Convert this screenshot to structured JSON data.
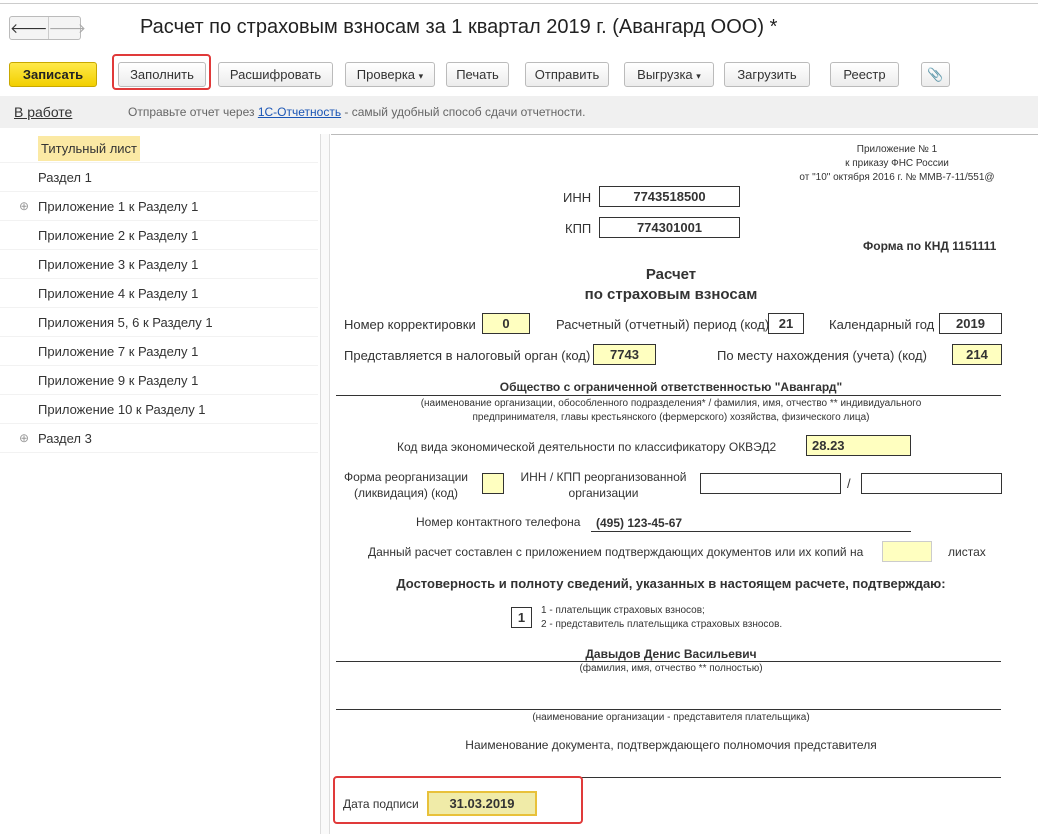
{
  "window": {
    "title": "Расчет по страховым взносам за 1 квартал 2019 г. (Авангард ООО) *",
    "back": "🡐",
    "forward": "🡒"
  },
  "toolbar": {
    "save": "Записать",
    "fill": "Заполнить",
    "decode": "Расшифровать",
    "check": "Проверка",
    "print": "Печать",
    "send": "Отправить",
    "export": "Выгрузка",
    "import": "Загрузить",
    "registry": "Реестр",
    "dropdown": "▾",
    "attach": "📎"
  },
  "infobar": {
    "status": "В работе",
    "text_before": "Отправьте отчет через ",
    "link": "1С-Отчетность",
    "text_after": " - самый удобный способ сдачи отчетности."
  },
  "tree": [
    {
      "label": "Титульный лист",
      "selected": true
    },
    {
      "label": "Раздел 1"
    },
    {
      "label": "Приложение 1 к Разделу 1",
      "expand": "⊕"
    },
    {
      "label": "Приложение 2 к Разделу 1"
    },
    {
      "label": "Приложение 3 к Разделу 1"
    },
    {
      "label": "Приложение 4 к Разделу 1"
    },
    {
      "label": "Приложения 5, 6 к Разделу 1"
    },
    {
      "label": "Приложение 7 к Разделу 1"
    },
    {
      "label": "Приложение 9 к Разделу 1"
    },
    {
      "label": "Приложение 10 к Разделу 1"
    },
    {
      "label": "Раздел 3",
      "expand": "⊕"
    }
  ],
  "form": {
    "header1": "Приложение № 1",
    "header2": "к приказу ФНС России",
    "header3": "от \"10\" октября 2016 г. № ММВ-7-11/551@",
    "inn_label": "ИНН",
    "inn": "7743518500",
    "kpp_label": "КПП",
    "kpp": "774301001",
    "knd": "Форма по КНД 1151111",
    "title1": "Расчет",
    "title2": "по страховым взносам",
    "corr_label": "Номер корректировки",
    "corr": "0",
    "period_label": "Расчетный (отчетный) период (код)",
    "period": "21",
    "year_label": "Календарный год",
    "year": "2019",
    "tax_label": "Представляется в налоговый орган (код)",
    "tax": "7743",
    "place_label": "По месту нахождения (учета) (код)",
    "place": "214",
    "org": "Общество с ограниченной ответственностью \"Авангард\"",
    "org_hint1": "(наименование организации, обособленного подразделения* / фамилия, имя, отчество ** индивидуального",
    "org_hint2": "предпринимателя, главы крестьянского (фермерского) хозяйства, физического лица)",
    "okved_label": "Код вида экономической деятельности по классификатору ОКВЭД2",
    "okved": "28.23",
    "reorg_label1": "Форма реорганизации",
    "reorg_label2": "(ликвидация) (код)",
    "reorg_inn_label1": "ИНН / КПП реорганизованной",
    "reorg_inn_label2": "организации",
    "slash": "/",
    "phone_label": "Номер контактного телефона",
    "phone": "(495) 123-45-67",
    "pages_label": "Данный расчет составлен с приложением подтверждающих документов или их копий на",
    "pages_suffix": "листах",
    "confirm": "Достоверность и полноту сведений, указанных в настоящем расчете, подтверждаю:",
    "signer": "1",
    "signer_opt1": "1 - плательщик страховых взносов;",
    "signer_opt2": "2 - представитель плательщика страховых взносов.",
    "fio": "Давыдов Денис Васильевич",
    "fio_hint": "(фамилия, имя, отчество **  полностью)",
    "rep_hint": "(наименование организации - представителя плательщика)",
    "doc_label": "Наименование документа, подтверждающего полномочия представителя",
    "date_label": "Дата подписи",
    "date": "31.03.2019"
  }
}
